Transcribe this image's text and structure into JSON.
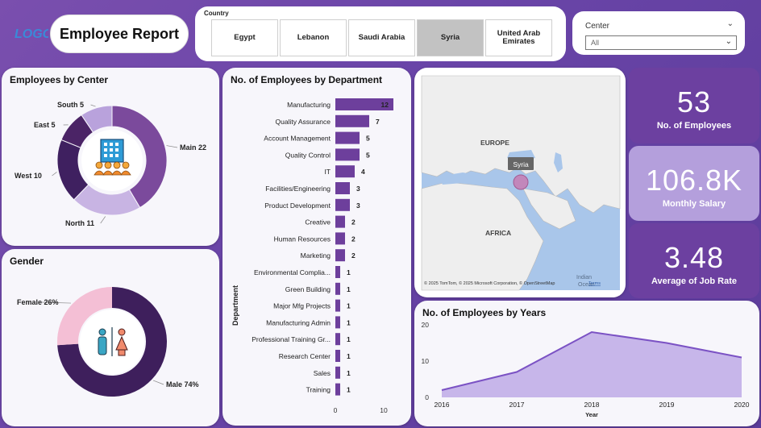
{
  "header": {
    "logo_text": "LOGO",
    "title": "Employee Report"
  },
  "country_filter": {
    "label": "Country",
    "options": [
      {
        "label": "Egypt",
        "selected": false
      },
      {
        "label": "Lebanon",
        "selected": false
      },
      {
        "label": "Saudi Arabia",
        "selected": false
      },
      {
        "label": "Syria",
        "selected": true
      },
      {
        "label": "United Arab Emirates",
        "selected": false
      }
    ]
  },
  "center_filter": {
    "label": "Center",
    "value": "All"
  },
  "map": {
    "labels": {
      "europe": "EUROPE",
      "africa": "AFRICA",
      "indian": "Indian",
      "ocean": "Ocean"
    },
    "tooltip": "Syria",
    "attribution": "© 2025 TomTom, © 2025 Microsoft Corporation, © OpenStreetMap",
    "terms": "Terms"
  },
  "kpis": [
    {
      "value": "53",
      "label": "No. of Employees",
      "bg": "#6c40a0"
    },
    {
      "value": "106.8K",
      "label": "Monthly Salary",
      "bg": "#b49fdc"
    },
    {
      "value": "3.48",
      "label": "Average of Job Rate",
      "bg": "#6c40a0"
    }
  ],
  "colors": {
    "dark_purple": "#3e1f5c",
    "mid_purple": "#7b4a9c",
    "light_purple": "#c8b4e3",
    "bar_purple": "#6d3f9c",
    "pink": "#f4bfd5",
    "area_fill": "#c7b6ea",
    "area_line": "#7b52c4"
  },
  "chart_data": [
    {
      "type": "pie",
      "title": "Employees by Center",
      "categories": [
        "Main",
        "North",
        "West",
        "East",
        "South"
      ],
      "values": [
        22,
        11,
        10,
        5,
        5
      ],
      "labels": [
        "Main 22",
        "North 11",
        "West 10",
        "East 5",
        "South 5"
      ]
    },
    {
      "type": "pie",
      "title": "Gender",
      "categories": [
        "Male",
        "Female"
      ],
      "values": [
        74,
        26
      ],
      "labels": [
        "Male 74%",
        "Female 26%"
      ]
    },
    {
      "type": "bar",
      "title": "No. of Employees by Department",
      "ylabel": "Department",
      "categories": [
        "Manufacturing",
        "Quality Assurance",
        "Account Management",
        "Quality Control",
        "IT",
        "Facilities/Engineering",
        "Product Development",
        "Creative",
        "Human Resources",
        "Marketing",
        "Environmental Complia...",
        "Green Building",
        "Major Mfg Projects",
        "Manufacturing Admin",
        "Professional Training Gr...",
        "Research Center",
        "Sales",
        "Training"
      ],
      "values": [
        12,
        7,
        5,
        5,
        4,
        3,
        3,
        2,
        2,
        2,
        1,
        1,
        1,
        1,
        1,
        1,
        1,
        1
      ],
      "xticks": [
        "0",
        "10"
      ],
      "xlim": [
        0,
        13
      ]
    },
    {
      "type": "area",
      "title": "No. of Employees by Years",
      "xlabel": "Year",
      "x": [
        "2016",
        "2017",
        "2018",
        "2019",
        "2020"
      ],
      "values": [
        2,
        7,
        18,
        15,
        11
      ],
      "yticks": [
        "0",
        "10",
        "20"
      ],
      "ylim": [
        0,
        20
      ]
    }
  ]
}
